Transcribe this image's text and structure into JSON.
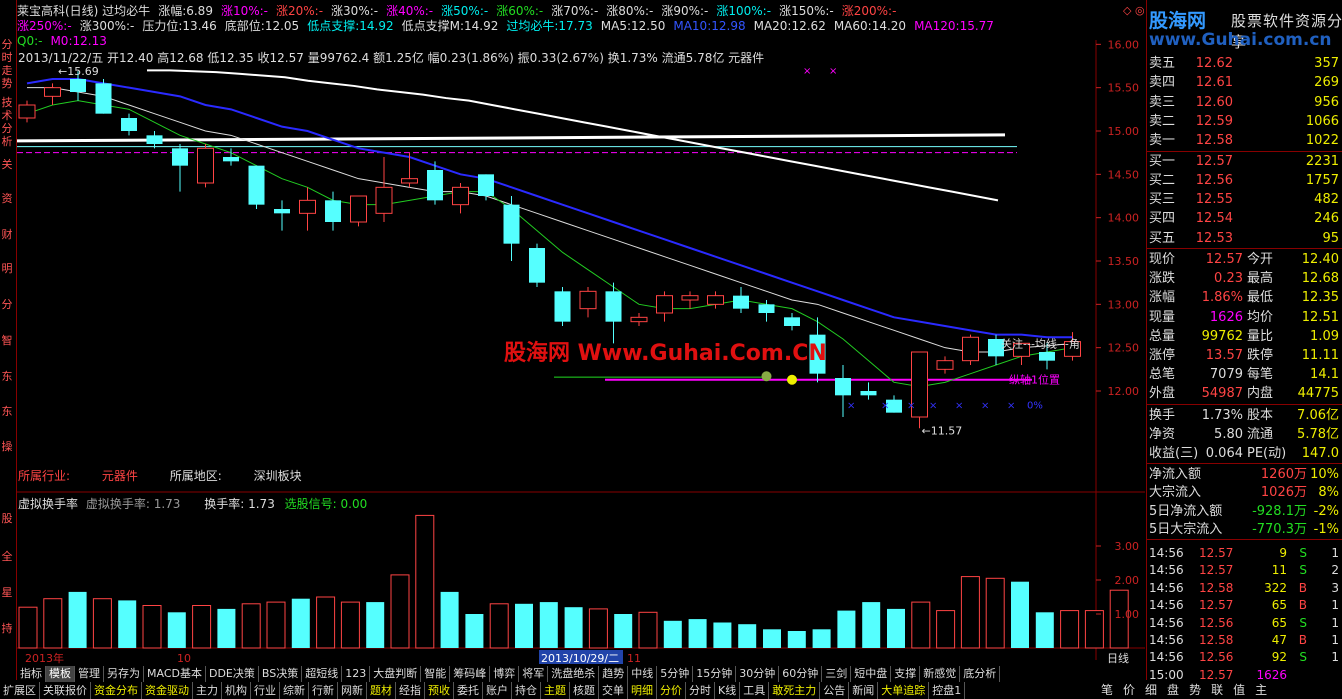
{
  "left_bar": [
    "分时走势",
    "技术分析",
    "关",
    "资",
    "财",
    "明",
    "分",
    "智",
    "东",
    "东",
    "操",
    "股",
    "全",
    "星",
    "持"
  ],
  "header_row1": [
    {
      "t": "莱宝高科(日线) 过均必牛",
      "c": "#ddd"
    },
    {
      "t": "涨幅:6.89",
      "c": "#ddd"
    },
    {
      "t": "涨10%:-",
      "c": "#f0f"
    },
    {
      "t": "涨20%:-",
      "c": "#f44"
    },
    {
      "t": "涨30%:-",
      "c": "#ddd"
    },
    {
      "t": "涨40%:-",
      "c": "#f0f"
    },
    {
      "t": "涨50%:-",
      "c": "#0ee"
    },
    {
      "t": "涨60%:-",
      "c": "#2d2"
    },
    {
      "t": "涨70%:-",
      "c": "#ddd"
    },
    {
      "t": "涨80%:-",
      "c": "#ddd"
    },
    {
      "t": "涨90%:-",
      "c": "#ddd"
    },
    {
      "t": "涨100%:-",
      "c": "#0ee"
    },
    {
      "t": "涨150%:-",
      "c": "#ddd"
    },
    {
      "t": "涨200%:-",
      "c": "#f44"
    }
  ],
  "header_row2": [
    {
      "t": "涨250%:-",
      "c": "#f0f"
    },
    {
      "t": "涨300%:-",
      "c": "#ddd"
    },
    {
      "t": "压力位:13.46",
      "c": "#ddd"
    },
    {
      "t": "底部位:12.05",
      "c": "#ddd"
    },
    {
      "t": "低点支撑:14.92",
      "c": "#0ee"
    },
    {
      "t": "低点支撑M:14.92",
      "c": "#ddd"
    },
    {
      "t": "过均必牛:17.73",
      "c": "#0ee"
    },
    {
      "t": "MA5:12.50",
      "c": "#ddd"
    },
    {
      "t": "MA10:12.98",
      "c": "#3355ff"
    },
    {
      "t": "MA20:12.62",
      "c": "#ddd"
    },
    {
      "t": "MA60:14.20",
      "c": "#ddd"
    },
    {
      "t": "MA120:15.77",
      "c": "#f0f"
    }
  ],
  "header_row3": [
    {
      "t": "Q0:-",
      "c": "#2d2"
    },
    {
      "t": "M0:12.13",
      "c": "#f0f"
    }
  ],
  "info_line": "2013/11/22/五 开12.40 高12.68 低12.35 收12.57 量99762.4 额1.25亿 幅0.23(1.86%) 振0.33(2.67%) 换1.73% 流通5.78亿 元器件",
  "industry": {
    "label1": "所属行业:",
    "v1": "元器件",
    "label2": "所属地区:",
    "v2": "深圳板块"
  },
  "watermark": "股海网 Www.Guhai.Com.CN",
  "annotations": {
    "high": "15.69",
    "low": "11.57",
    "ma_note": "关注---均线---角",
    "axis_note": "纵轴1位置",
    "zero": "0%"
  },
  "price_axis": [
    "16.00",
    "15.50",
    "15.00",
    "14.50",
    "14.00",
    "13.50",
    "13.00",
    "12.50",
    "12.00"
  ],
  "vol_header": {
    "a": "虚拟换手率",
    "b": "虚拟换手率: 1.73",
    "c": "换手率: 1.73",
    "d": "选股信号: 0.00"
  },
  "vol_axis": [
    "3.00",
    "2.00",
    "1.00"
  ],
  "date_axis": {
    "left": "2013年",
    "m1": "10",
    "sel": "2013/10/29/二",
    "m2": "11",
    "right": "日线"
  },
  "chart_data": {
    "type": "candlestick",
    "ylim": [
      11.4,
      16.2
    ],
    "candles": [
      [
        15.15,
        15.35,
        15.1,
        15.3
      ],
      [
        15.4,
        15.55,
        15.3,
        15.5
      ],
      [
        15.6,
        15.69,
        15.35,
        15.45
      ],
      [
        15.55,
        15.6,
        15.2,
        15.2
      ],
      [
        15.15,
        15.2,
        14.95,
        15.0
      ],
      [
        14.95,
        15.0,
        14.8,
        14.85
      ],
      [
        14.8,
        14.85,
        14.3,
        14.6
      ],
      [
        14.4,
        14.85,
        14.35,
        14.8
      ],
      [
        14.7,
        14.8,
        14.6,
        14.65
      ],
      [
        14.6,
        14.6,
        14.1,
        14.15
      ],
      [
        14.1,
        14.2,
        13.85,
        14.05
      ],
      [
        14.05,
        14.35,
        13.85,
        14.2
      ],
      [
        14.2,
        14.3,
        13.85,
        13.95
      ],
      [
        13.95,
        14.2,
        13.9,
        14.25
      ],
      [
        14.05,
        14.7,
        13.95,
        14.35
      ],
      [
        14.4,
        14.75,
        14.35,
        14.45
      ],
      [
        14.55,
        14.65,
        14.15,
        14.2
      ],
      [
        14.15,
        14.4,
        14.05,
        14.35
      ],
      [
        14.5,
        14.5,
        14.2,
        14.25
      ],
      [
        14.15,
        14.25,
        13.5,
        13.7
      ],
      [
        13.65,
        13.7,
        13.2,
        13.25
      ],
      [
        13.15,
        13.2,
        12.75,
        12.8
      ],
      [
        12.95,
        13.2,
        12.85,
        13.15
      ],
      [
        13.15,
        13.25,
        12.55,
        12.8
      ],
      [
        12.8,
        12.9,
        12.75,
        12.85
      ],
      [
        12.9,
        13.15,
        12.8,
        13.1
      ],
      [
        13.05,
        13.15,
        12.95,
        13.1
      ],
      [
        13.0,
        13.15,
        12.95,
        13.1
      ],
      [
        13.1,
        13.2,
        12.9,
        12.95
      ],
      [
        13.0,
        13.05,
        12.8,
        12.9
      ],
      [
        12.85,
        12.9,
        12.7,
        12.75
      ],
      [
        12.65,
        12.85,
        12.1,
        12.2
      ],
      [
        12.15,
        12.3,
        11.7,
        11.95
      ],
      [
        12.0,
        12.1,
        11.9,
        11.95
      ],
      [
        11.9,
        11.95,
        11.75,
        11.75
      ],
      [
        11.7,
        12.45,
        11.57,
        12.45
      ],
      [
        12.25,
        12.4,
        12.2,
        12.35
      ],
      [
        12.35,
        12.65,
        12.3,
        12.62
      ],
      [
        12.6,
        12.65,
        12.3,
        12.4
      ],
      [
        12.4,
        12.55,
        12.3,
        12.55
      ],
      [
        12.45,
        12.55,
        12.25,
        12.35
      ],
      [
        12.4,
        12.68,
        12.35,
        12.57
      ]
    ],
    "ma5": [
      15.2,
      15.3,
      15.35,
      15.3,
      15.25,
      15.1,
      14.95,
      14.85,
      14.75,
      14.6,
      14.45,
      14.35,
      14.2,
      14.15,
      14.15,
      14.2,
      14.25,
      14.3,
      14.3,
      14.1,
      13.85,
      13.6,
      13.4,
      13.2,
      13.0,
      12.95,
      12.95,
      13.0,
      13.05,
      13.0,
      12.95,
      12.8,
      12.6,
      12.35,
      12.1,
      12.05,
      12.1,
      12.2,
      12.3,
      12.4,
      12.45,
      12.5
    ],
    "ma10": [
      15.5,
      15.5,
      15.45,
      15.4,
      15.3,
      15.2,
      15.1,
      15.0,
      14.95,
      14.85,
      14.75,
      14.65,
      14.55,
      14.45,
      14.4,
      14.35,
      14.3,
      14.3,
      14.25,
      14.15,
      14.05,
      13.95,
      13.85,
      13.75,
      13.65,
      13.55,
      13.45,
      13.35,
      13.25,
      13.15,
      13.05,
      13.0,
      12.9,
      12.8,
      12.7,
      12.6,
      12.5,
      12.45,
      12.45,
      12.5,
      12.52,
      12.55
    ],
    "ma20": [
      15.55,
      15.6,
      15.6,
      15.55,
      15.5,
      15.45,
      15.4,
      15.3,
      15.25,
      15.15,
      15.05,
      15.0,
      14.9,
      14.8,
      14.75,
      14.7,
      14.6,
      14.5,
      14.45,
      14.35,
      14.25,
      14.15,
      14.05,
      13.95,
      13.85,
      13.75,
      13.65,
      13.55,
      13.45,
      13.35,
      13.25,
      13.15,
      13.05,
      12.95,
      12.85,
      12.8,
      12.75,
      12.7,
      12.65,
      12.65,
      12.62,
      12.62
    ],
    "ma60": [
      15.7,
      15.7,
      15.69,
      15.68,
      15.66,
      15.64,
      15.62,
      15.58,
      15.55,
      15.52,
      15.48,
      15.45,
      15.42,
      15.38,
      15.35,
      15.3,
      15.25,
      15.2,
      15.15,
      15.1,
      15.05,
      15.0,
      14.95,
      14.9,
      14.85,
      14.8,
      14.75,
      14.7,
      14.65,
      14.6,
      14.55,
      14.5,
      14.45,
      14.4,
      14.35,
      14.3,
      14.25,
      14.2
    ],
    "vol": [
      1.2,
      1.45,
      1.65,
      1.45,
      1.4,
      1.25,
      1.05,
      1.25,
      1.15,
      1.3,
      1.35,
      1.45,
      1.5,
      1.35,
      1.35,
      2.15,
      3.9,
      1.65,
      1.0,
      1.3,
      1.3,
      1.35,
      1.2,
      1.15,
      1.0,
      1.05,
      0.8,
      0.85,
      0.75,
      0.7,
      0.55,
      0.5,
      0.55,
      1.1,
      1.35,
      1.15,
      1.35,
      1.1,
      2.1,
      2.05,
      1.95,
      1.05,
      1.1,
      1.1,
      1.7
    ],
    "vol_up": [
      1,
      1,
      0,
      1,
      0,
      1,
      0,
      1,
      0,
      1,
      1,
      0,
      1,
      1,
      0,
      1,
      1,
      0,
      0,
      1,
      0,
      0,
      0,
      1,
      0,
      1,
      0,
      0,
      0,
      0,
      0,
      0,
      0,
      0,
      0,
      0,
      1,
      1,
      1,
      1,
      0,
      0,
      1,
      1,
      1
    ],
    "price_levels": {
      "white_line": 14.92,
      "cyan_line": 14.82,
      "magenta_line": 14.75,
      "magenta_low": 12.13
    }
  },
  "right": {
    "logo1": "股海网",
    "logo2": "股票软件资源分享",
    "logo3": "www.Guhai.com.cn",
    "sell": [
      [
        "卖五",
        "12.62",
        "357"
      ],
      [
        "卖四",
        "12.61",
        "269"
      ],
      [
        "卖三",
        "12.60",
        "956"
      ],
      [
        "卖二",
        "12.59",
        "1066"
      ],
      [
        "卖一",
        "12.58",
        "1022"
      ]
    ],
    "buy": [
      [
        "买一",
        "12.57",
        "2231"
      ],
      [
        "买二",
        "12.56",
        "1757"
      ],
      [
        "买三",
        "12.55",
        "482"
      ],
      [
        "买四",
        "12.54",
        "246"
      ],
      [
        "买五",
        "12.53",
        "95"
      ]
    ],
    "stats": [
      [
        "现价",
        "12.57",
        "red",
        "今开",
        "12.40",
        "red"
      ],
      [
        "涨跌",
        "0.23",
        "red",
        "最高",
        "12.68",
        "red"
      ],
      [
        "涨幅",
        "1.86%",
        "red",
        "最低",
        "12.35",
        "red"
      ],
      [
        "现量",
        "1626",
        "mag",
        "均价",
        "12.51",
        "red"
      ],
      [
        "总量",
        "99762",
        "yel",
        "量比",
        "1.09",
        "yel"
      ],
      [
        "涨停",
        "13.57",
        "red",
        "跌停",
        "11.11",
        "grn"
      ],
      [
        "总笔",
        "7079",
        "wht",
        "每笔",
        "14.1",
        "wht"
      ],
      [
        "外盘",
        "54987",
        "red",
        "内盘",
        "44775",
        "grn"
      ]
    ],
    "fund": [
      [
        "换手",
        "1.73%",
        "wht",
        "股本",
        "7.06亿",
        "wht"
      ],
      [
        "净资",
        "5.80",
        "wht",
        "流通",
        "5.78亿",
        "wht"
      ],
      [
        "收益(三)",
        "0.064",
        "wht",
        "PE(动)",
        "147.0",
        "wht"
      ]
    ],
    "flow": [
      [
        "净流入额",
        "1260万",
        "red",
        "10%",
        "red"
      ],
      [
        "大宗流入",
        "1026万",
        "red",
        "8%",
        "red"
      ],
      [
        "5日净流入额",
        "-928.1万",
        "grn",
        "-2%",
        "grn"
      ],
      [
        "5日大宗流入",
        "-770.3万",
        "grn",
        "-1%",
        "grn"
      ]
    ],
    "ticks": [
      [
        "14:56",
        "12.57",
        "9",
        "S",
        "1"
      ],
      [
        "14:56",
        "12.57",
        "11",
        "S",
        "2"
      ],
      [
        "14:56",
        "12.58",
        "322",
        "B",
        "3"
      ],
      [
        "14:56",
        "12.57",
        "65",
        "B",
        "1"
      ],
      [
        "14:56",
        "12.56",
        "65",
        "S",
        "1"
      ],
      [
        "14:56",
        "12.58",
        "47",
        "B",
        "1"
      ],
      [
        "14:56",
        "12.56",
        "92",
        "S",
        "1"
      ],
      [
        "15:00",
        "12.57",
        "1626",
        "",
        " "
      ]
    ]
  },
  "tabs1": [
    "指标",
    "模板",
    "管理",
    "另存为",
    "MACD基本",
    "DDE决策",
    "BS决策",
    "超短线",
    "123",
    "大盘判断",
    "智能",
    "筹码峰",
    "博弈",
    "将军",
    "洗盘绝杀",
    "趋势",
    "中线",
    "5分钟",
    "15分钟",
    "30分钟",
    "60分钟",
    "三剑",
    "短中盘",
    "支撑",
    "新感觉",
    "底分析"
  ],
  "tabs2": [
    "扩展区",
    "关联报价",
    "资金分布",
    "资金驱动",
    "主力",
    "机构",
    "行业",
    "综新",
    "行新",
    "网新",
    "题材",
    "经指",
    "预收",
    "委托",
    "账户",
    "持仓",
    "主题",
    "核题",
    "交单",
    "明细",
    "分价",
    "分时",
    "K线",
    "工具",
    "敢死主力",
    "公告",
    "新闻",
    "大单追踪",
    "控盘1"
  ],
  "rtabs": [
    "笔",
    "价",
    "细",
    "盘",
    "势",
    "联",
    "值",
    "主"
  ]
}
